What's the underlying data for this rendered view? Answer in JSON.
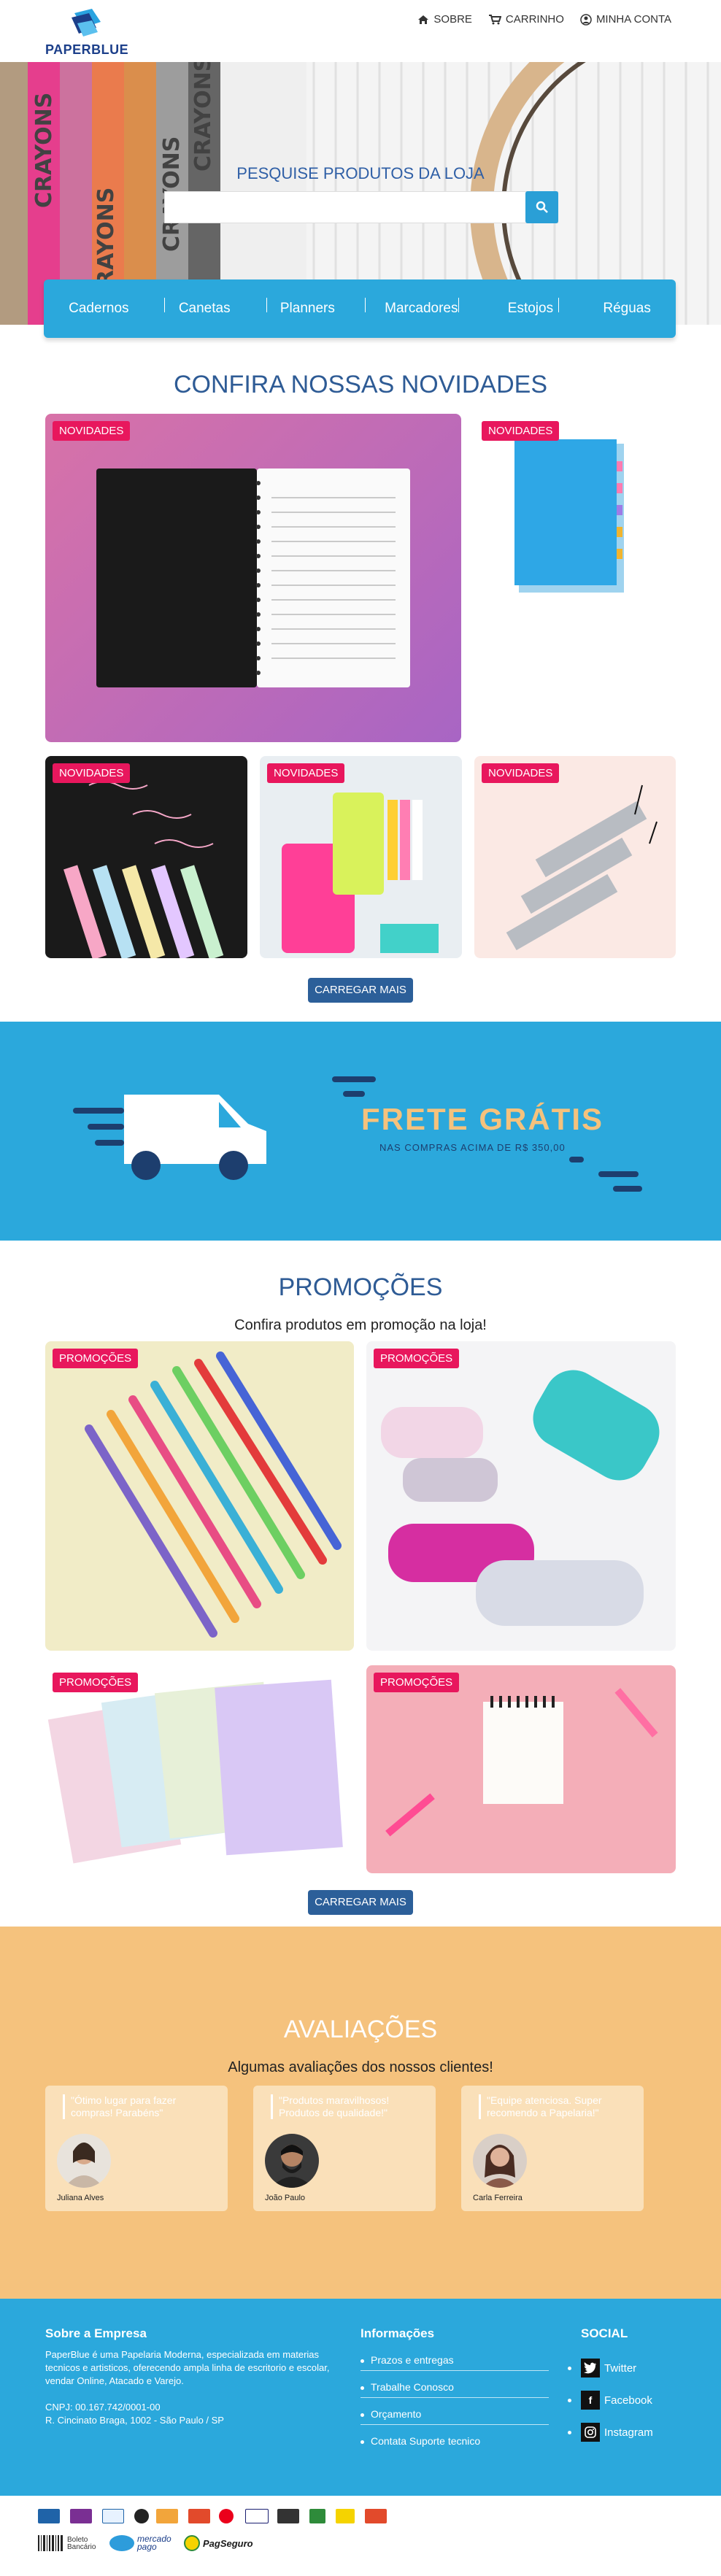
{
  "header": {
    "logo_text": "PAPERBLUE",
    "nav": [
      {
        "label": "SOBRE",
        "icon": "home-icon"
      },
      {
        "label": "CARRINHO",
        "icon": "cart-icon"
      },
      {
        "label": "MINHA CONTA",
        "icon": "user-icon"
      }
    ]
  },
  "hero": {
    "search_label": "PESQUISE PRODUTOS DA LOJA",
    "search_placeholder": "",
    "categories": [
      "Cadernos",
      "Canetas",
      "Planners",
      "Marcadores",
      "Estojos",
      "Réguas"
    ]
  },
  "novidades": {
    "title": "CONFIRA NOSSAS NOVIDADES",
    "badge": "NOVIDADES",
    "load_more": "CARREGAR MAIS"
  },
  "frete": {
    "title": "FRETE GRÁTIS",
    "subtitle": "NAS COMPRAS ACIMA DE R$ 350,00"
  },
  "promocoes": {
    "title": "PROMOÇÕES",
    "subtitle": "Confira produtos em promoção na loja!",
    "badge": "PROMOÇÕES",
    "load_more": "CARREGAR MAIS"
  },
  "reviews": {
    "title": "AVALIAÇÕES",
    "subtitle": "Algumas avaliações dos nossos clientes!",
    "items": [
      {
        "quote": "\"Ótimo lugar para fazer compras! Parabéns\"",
        "name": "Juliana Alves"
      },
      {
        "quote": "\"Produtos maravilhosos! Produtos de qualidade!\"",
        "name": "João Paulo"
      },
      {
        "quote": "\"Equipe atenciosa. Super recomendo a Papelaria!\"",
        "name": "Carla Ferreira"
      }
    ]
  },
  "footer": {
    "about_title": "Sobre a Empresa",
    "about_text": "PaperBlue é uma Papelaria Moderna, especializada em materias tecnicos e artisticos, oferecendo ampla linha de escritorio e escolar, vendar Online, Atacado e Varejo.",
    "cnpj": "CNPJ: 00.167.742/0001-00",
    "address": "R. Cincinato Braga, 1002 - São Paulo / SP",
    "info_title": "Informações",
    "info_links": [
      "Prazos e entregas",
      "Trabalhe Conosco",
      "Orçamento",
      "Contata Suporte tecnico"
    ],
    "social_title": "SOCIAL",
    "social": [
      {
        "label": "Twitter",
        "icon": "twitter-icon"
      },
      {
        "label": "Facebook",
        "icon": "facebook-icon"
      },
      {
        "label": "Instagram",
        "icon": "instagram-icon"
      }
    ]
  },
  "payments": {
    "boleto_label": "Boleto Bancário",
    "mercado_pago": "mercado pago",
    "pagseguro": "PagSeguro"
  }
}
